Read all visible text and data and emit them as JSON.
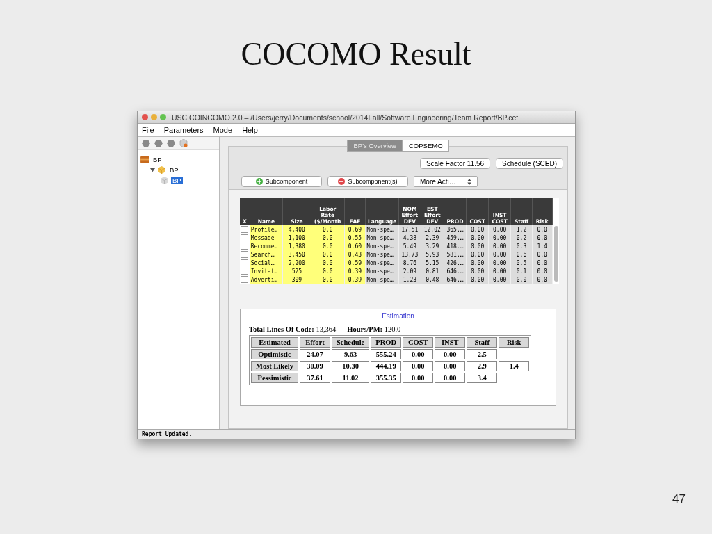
{
  "slide": {
    "title": "COCOMO Result",
    "number": "47"
  },
  "window": {
    "title": "USC COINCOMO 2.0 – /Users/jerry/Documents/school/2014Fall/Software Engineering/Team Report/BP.cet"
  },
  "menu": [
    "File",
    "Parameters",
    "Mode",
    "Help"
  ],
  "tree": [
    {
      "label": "BP",
      "kind": "project",
      "selected": false,
      "children": [
        {
          "label": "BP",
          "kind": "system",
          "selected": false,
          "expanded": true,
          "children": [
            {
              "label": "BP",
              "kind": "component",
              "selected": true
            }
          ]
        }
      ]
    }
  ],
  "tabs": [
    {
      "label": "BP's Overview",
      "selected": true
    },
    {
      "label": "COPSEMO",
      "selected": false
    }
  ],
  "top_buttons": [
    "Scale Factor 11.56",
    "Schedule (SCED)"
  ],
  "actions": [
    {
      "label": "Subcomponent",
      "kind": "add"
    },
    {
      "label": "Subcomponent(s)",
      "kind": "remove"
    },
    {
      "label": "More Acti…",
      "kind": "select"
    }
  ],
  "table": {
    "checkbox_header": "X",
    "columns": [
      {
        "label": "Name",
        "editable": true
      },
      {
        "label": "Size",
        "editable": true
      },
      {
        "label": "Labor\nRate\n($/Month",
        "editable": true
      },
      {
        "label": "EAF",
        "editable": true
      },
      {
        "label": "Language",
        "editable": false
      },
      {
        "label": "NOM\nEffort\nDEV",
        "editable": false
      },
      {
        "label": "EST\nEffort\nDEV",
        "editable": false
      },
      {
        "label": "PROD",
        "editable": false
      },
      {
        "label": "COST",
        "editable": false
      },
      {
        "label": "INST\nCOST",
        "editable": false
      },
      {
        "label": "Staff",
        "editable": false
      },
      {
        "label": "Risk",
        "editable": false
      }
    ],
    "rows": [
      {
        "checked": false,
        "cells": [
          "Profile…",
          "4,400",
          "0.0",
          "0.69",
          "Non-spe…",
          "17.51",
          "12.02",
          "365.…",
          "0.00",
          "0.00",
          "1.2",
          "0.0"
        ]
      },
      {
        "checked": false,
        "cells": [
          "Message",
          "1,100",
          "0.0",
          "0.55",
          "Non-spe…",
          "4.38",
          "2.39",
          "459.…",
          "0.00",
          "0.00",
          "0.2",
          "0.0"
        ]
      },
      {
        "checked": false,
        "cells": [
          "Recomme…",
          "1,380",
          "0.0",
          "0.60",
          "Non-spe…",
          "5.49",
          "3.29",
          "418.…",
          "0.00",
          "0.00",
          "0.3",
          "1.4"
        ]
      },
      {
        "checked": false,
        "cells": [
          "Search…",
          "3,450",
          "0.0",
          "0.43",
          "Non-spe…",
          "13.73",
          "5.93",
          "581.…",
          "0.00",
          "0.00",
          "0.6",
          "0.0"
        ]
      },
      {
        "checked": false,
        "cells": [
          "Social…",
          "2,200",
          "0.0",
          "0.59",
          "Non-spe…",
          "8.76",
          "5.15",
          "426.…",
          "0.00",
          "0.00",
          "0.5",
          "0.0"
        ]
      },
      {
        "checked": false,
        "cells": [
          "Invitat…",
          "525",
          "0.0",
          "0.39",
          "Non-spe…",
          "2.09",
          "0.81",
          "646.…",
          "0.00",
          "0.00",
          "0.1",
          "0.0"
        ]
      },
      {
        "checked": false,
        "cells": [
          "Adverti…",
          "309",
          "0.0",
          "0.39",
          "Non-spe…",
          "1.23",
          "0.48",
          "646.…",
          "0.00",
          "0.00",
          "0.0",
          "0.0"
        ]
      }
    ]
  },
  "estimation": {
    "title": "Estimation",
    "summary": [
      {
        "label": "Total Lines Of Code:",
        "value": "13,364"
      },
      {
        "label": "Hours/PM:",
        "value": "120.0"
      }
    ],
    "columns": [
      "Estimated",
      "Effort",
      "Schedule",
      "PROD",
      "COST",
      "INST",
      "Staff",
      "Risk"
    ],
    "rows": [
      [
        "Optimistic",
        "24.07",
        "9.63",
        "555.24",
        "0.00",
        "0.00",
        "2.5",
        null
      ],
      [
        "Most Likely",
        "30.09",
        "10.30",
        "444.19",
        "0.00",
        "0.00",
        "2.9",
        "1.4"
      ],
      [
        "Pessimistic",
        "37.61",
        "11.02",
        "355.35",
        "0.00",
        "0.00",
        "3.4",
        null
      ]
    ]
  },
  "status_bar": "Report Updated."
}
